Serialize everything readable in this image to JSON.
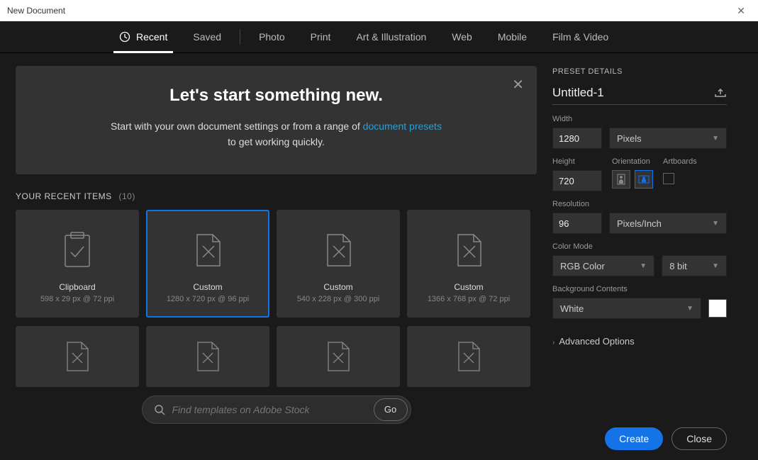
{
  "window": {
    "title": "New Document"
  },
  "tabs": {
    "recent": "Recent",
    "saved": "Saved",
    "photo": "Photo",
    "print": "Print",
    "art": "Art & Illustration",
    "web": "Web",
    "mobile": "Mobile",
    "film": "Film & Video"
  },
  "hero": {
    "title": "Let's start something new.",
    "line1a": "Start with your own document settings or from a range of ",
    "link": "document presets",
    "line2": "to get working quickly."
  },
  "section": {
    "label": "YOUR RECENT ITEMS",
    "count": "(10)"
  },
  "cards": [
    {
      "title": "Clipboard",
      "sub": "598 x 29 px @ 72 ppi"
    },
    {
      "title": "Custom",
      "sub": "1280 x 720 px @ 96 ppi"
    },
    {
      "title": "Custom",
      "sub": "540 x 228 px @ 300 ppi"
    },
    {
      "title": "Custom",
      "sub": "1366 x 768 px @ 72 ppi"
    }
  ],
  "search": {
    "placeholder": "Find templates on Adobe Stock",
    "go": "Go"
  },
  "details": {
    "head": "PRESET DETAILS",
    "docname": "Untitled-1",
    "widthLabel": "Width",
    "width": "1280",
    "unit": "Pixels",
    "heightLabel": "Height",
    "height": "720",
    "orientLabel": "Orientation",
    "artLabel": "Artboards",
    "resLabel": "Resolution",
    "res": "96",
    "resUnit": "Pixels/Inch",
    "colorLabel": "Color Mode",
    "colorMode": "RGB Color",
    "bitDepth": "8 bit",
    "bgLabel": "Background Contents",
    "bg": "White",
    "advanced": "Advanced Options"
  },
  "buttons": {
    "create": "Create",
    "close": "Close"
  }
}
